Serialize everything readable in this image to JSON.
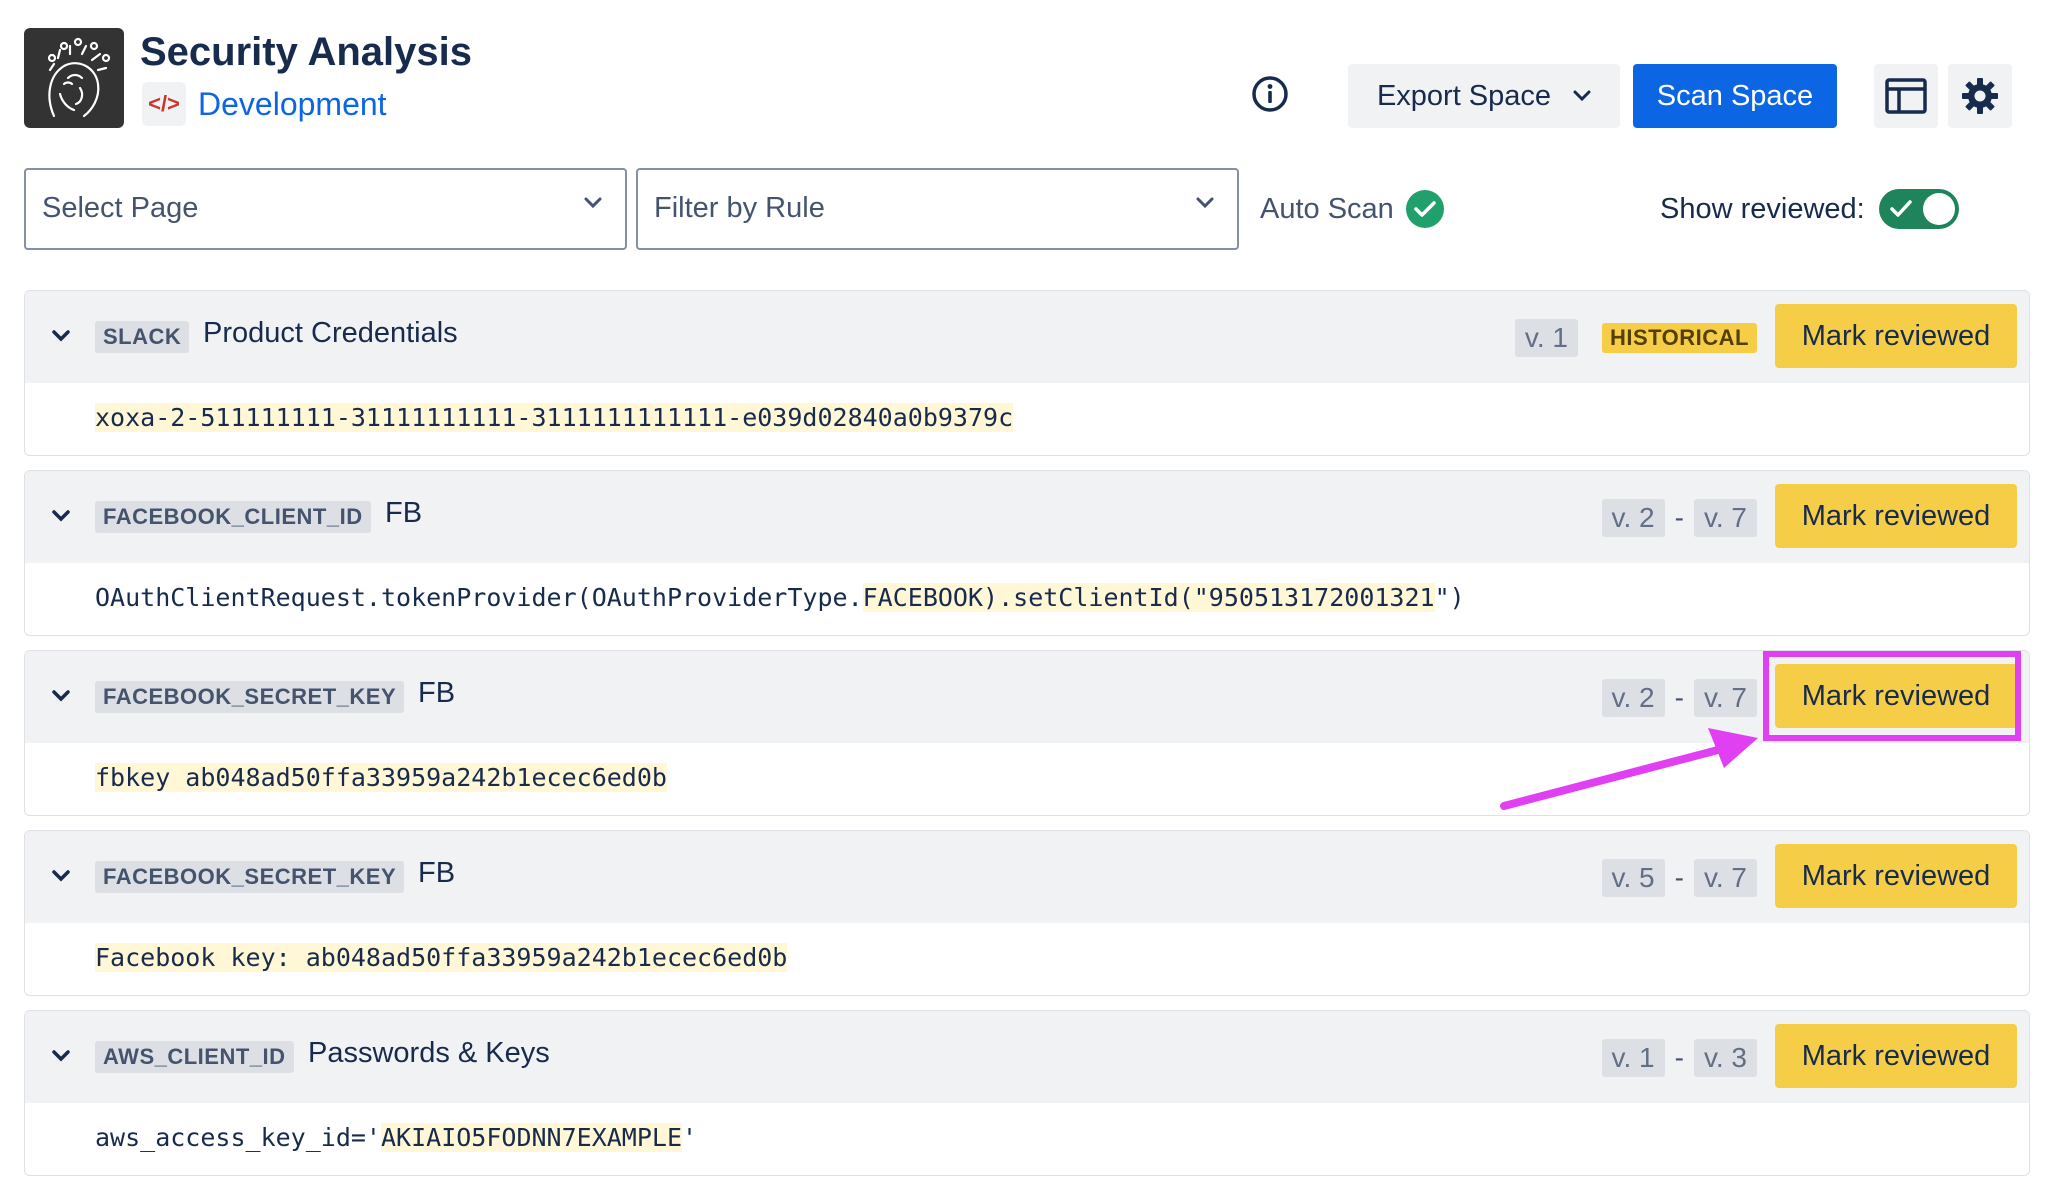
{
  "header": {
    "app_title": "Security Analysis",
    "space_icon_text": "</>",
    "space_name": "Development",
    "export_label": "Export Space",
    "scan_label": "Scan Space",
    "info_icon": "info-icon",
    "layout_icon": "sidebar-layout-icon",
    "settings_icon": "gear-icon"
  },
  "filters": {
    "select_page_placeholder": "Select Page",
    "filter_rule_placeholder": "Filter by Rule",
    "auto_scan_label": "Auto Scan",
    "show_reviewed_label": "Show reviewed:",
    "show_reviewed_on": true
  },
  "findings": [
    {
      "rule": "SLACK",
      "title": "Product Credentials",
      "versions": [
        "v. 1"
      ],
      "historical_label": "HISTORICAL",
      "mark_label": "Mark reviewed",
      "code_parts": [
        "",
        "xoxa-2-511111111-31111111111-3111111111111-e039d02840a0b9379c",
        ""
      ]
    },
    {
      "rule": "FACEBOOK_CLIENT_ID",
      "title": "FB",
      "versions": [
        "v. 2",
        "v. 7"
      ],
      "separator": "-",
      "mark_label": "Mark reviewed",
      "code_parts": [
        "OAuthClientRequest.tokenProvider(OAuthProviderType.",
        "FACEBOOK).setClientId(\"950513172001321",
        "\")"
      ]
    },
    {
      "rule": "FACEBOOK_SECRET_KEY",
      "title": "FB",
      "versions": [
        "v. 2",
        "v. 7"
      ],
      "separator": "-",
      "mark_label": "Mark reviewed",
      "code_parts": [
        "",
        "fbkey ab048ad50ffa33959a242b1ecec6ed0b",
        ""
      ]
    },
    {
      "rule": "FACEBOOK_SECRET_KEY",
      "title": "FB",
      "versions": [
        "v. 5",
        "v. 7"
      ],
      "separator": "-",
      "mark_label": "Mark reviewed",
      "code_parts": [
        "",
        "Facebook key: ab048ad50ffa33959a242b1ecec6ed0b",
        ""
      ]
    },
    {
      "rule": "AWS_CLIENT_ID",
      "title": "Passwords & Keys",
      "versions": [
        "v. 1",
        "v. 3"
      ],
      "separator": "-",
      "mark_label": "Mark reviewed",
      "code_parts": [
        "aws_access_key_id='",
        "AKIAIO5FODNN7EXAMPLE",
        "'"
      ]
    }
  ],
  "colors": {
    "primary": "#0c66e4",
    "mark_button": "#f5cd47",
    "toggle_on": "#1f845a",
    "annotation": "#e040f2"
  }
}
